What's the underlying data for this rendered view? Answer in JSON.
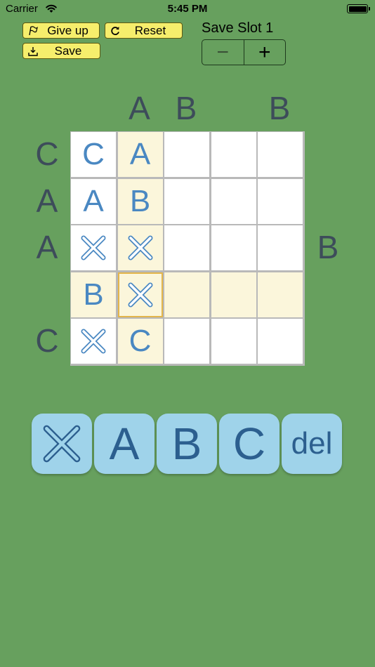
{
  "status_bar": {
    "carrier": "Carrier",
    "time": "5:45 PM"
  },
  "toolbar": {
    "give_up_label": "Give up",
    "reset_label": "Reset",
    "save_label": "Save"
  },
  "save_slot": {
    "label": "Save Slot 1",
    "minus_label": "−",
    "plus_label": "+"
  },
  "clues": {
    "top": [
      "A",
      "B",
      "",
      "B"
    ],
    "left": [
      "C",
      "A",
      "A",
      "",
      "C"
    ],
    "right": [
      "",
      "",
      "B",
      "",
      ""
    ]
  },
  "grid": {
    "rows": [
      [
        "C",
        "A",
        "",
        "",
        ""
      ],
      [
        "A",
        "B",
        "",
        "",
        ""
      ],
      [
        "×",
        "×",
        "",
        "",
        ""
      ],
      [
        "B",
        "×",
        "",
        "",
        ""
      ],
      [
        "×",
        "C",
        "",
        "",
        ""
      ]
    ],
    "selected": {
      "row": 3,
      "col": 1
    }
  },
  "keypad": [
    "×",
    "A",
    "B",
    "C",
    "del"
  ],
  "colors": {
    "background": "#67a05e",
    "cell_empty": "#ffffff",
    "cell_highlight": "#fbf6db",
    "selected_border": "#e3b54a",
    "letter": "#4a88c2",
    "clue": "#3d4c5a",
    "key_bg": "#9fd3ea",
    "key_text": "#2c5f8f",
    "button_yellow": "#f6ee6c"
  }
}
